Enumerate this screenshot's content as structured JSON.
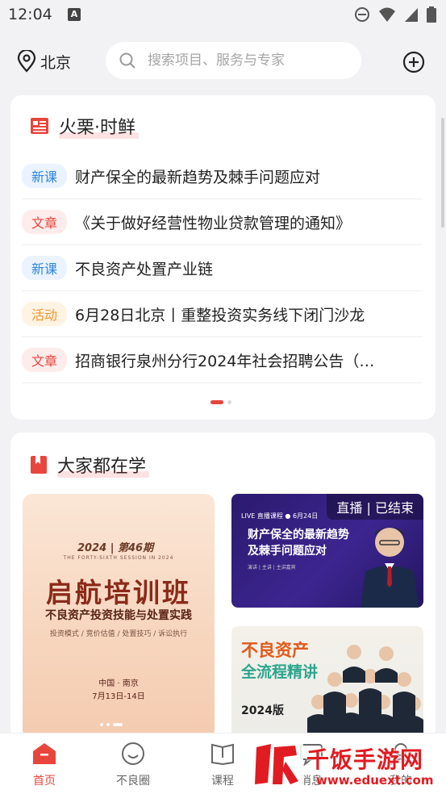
{
  "status_bar": {
    "time": "12:04",
    "notif_icon": "A"
  },
  "header": {
    "location": "北京",
    "search_placeholder": "搜索项目、服务与专家"
  },
  "news_section": {
    "title": "火栗·时鲜",
    "items": [
      {
        "tag": "新课",
        "tag_color": "blue",
        "text": "财产保全的最新趋势及棘手问题应对"
      },
      {
        "tag": "文章",
        "tag_color": "red",
        "text": "《关于做好经营性物业贷款管理的通知》"
      },
      {
        "tag": "新课",
        "tag_color": "blue",
        "text": "不良资产处置产业链"
      },
      {
        "tag": "活动",
        "tag_color": "orange",
        "text": "6月28日北京丨重整投资实务线下闭门沙龙"
      },
      {
        "tag": "文章",
        "tag_color": "red",
        "text": "招商银行泉州分行2024年社会招聘公告（…"
      }
    ]
  },
  "learning_section": {
    "title": "大家都在学",
    "poster_left": {
      "year": "2024 | 第46期",
      "subtitle": "THE FORTY-SIXTH SESSION IN 2024",
      "title": "启航培训班",
      "line": "不良资产投资技能与处置实践",
      "tags": "投资模式 / 竞价估值 / 处置技巧 / 诉讼执行",
      "place": "中国 · 南京",
      "date": "7月13日-14日"
    },
    "poster_r1": {
      "badge": "直播 | 已结束",
      "live": "LIVE 直播课程  ● 6月24日",
      "title1": "财产保全的最新趋势",
      "title2": "及棘手问题应对",
      "meta": "演讲 | 主讲 | 主讲嘉宾"
    },
    "poster_r2": {
      "title1": "不良资产",
      "title2": "全流程精讲",
      "year": "2024版"
    }
  },
  "tabbar": {
    "tabs": [
      {
        "label": "首页",
        "icon": "home-icon",
        "active": true
      },
      {
        "label": "不良圈",
        "icon": "smile-icon",
        "active": false
      },
      {
        "label": "课程",
        "icon": "book-icon",
        "active": false
      },
      {
        "label": "消息",
        "icon": "message-icon",
        "active": false
      },
      {
        "label": "我的",
        "icon": "user-icon",
        "active": false
      }
    ]
  },
  "watermark": {
    "name": "千饭手游网",
    "url": "www.eduext.com"
  },
  "colors": {
    "accent": "#e8453c",
    "blue_tag": "#2e86de",
    "orange_tag": "#f0952b"
  }
}
